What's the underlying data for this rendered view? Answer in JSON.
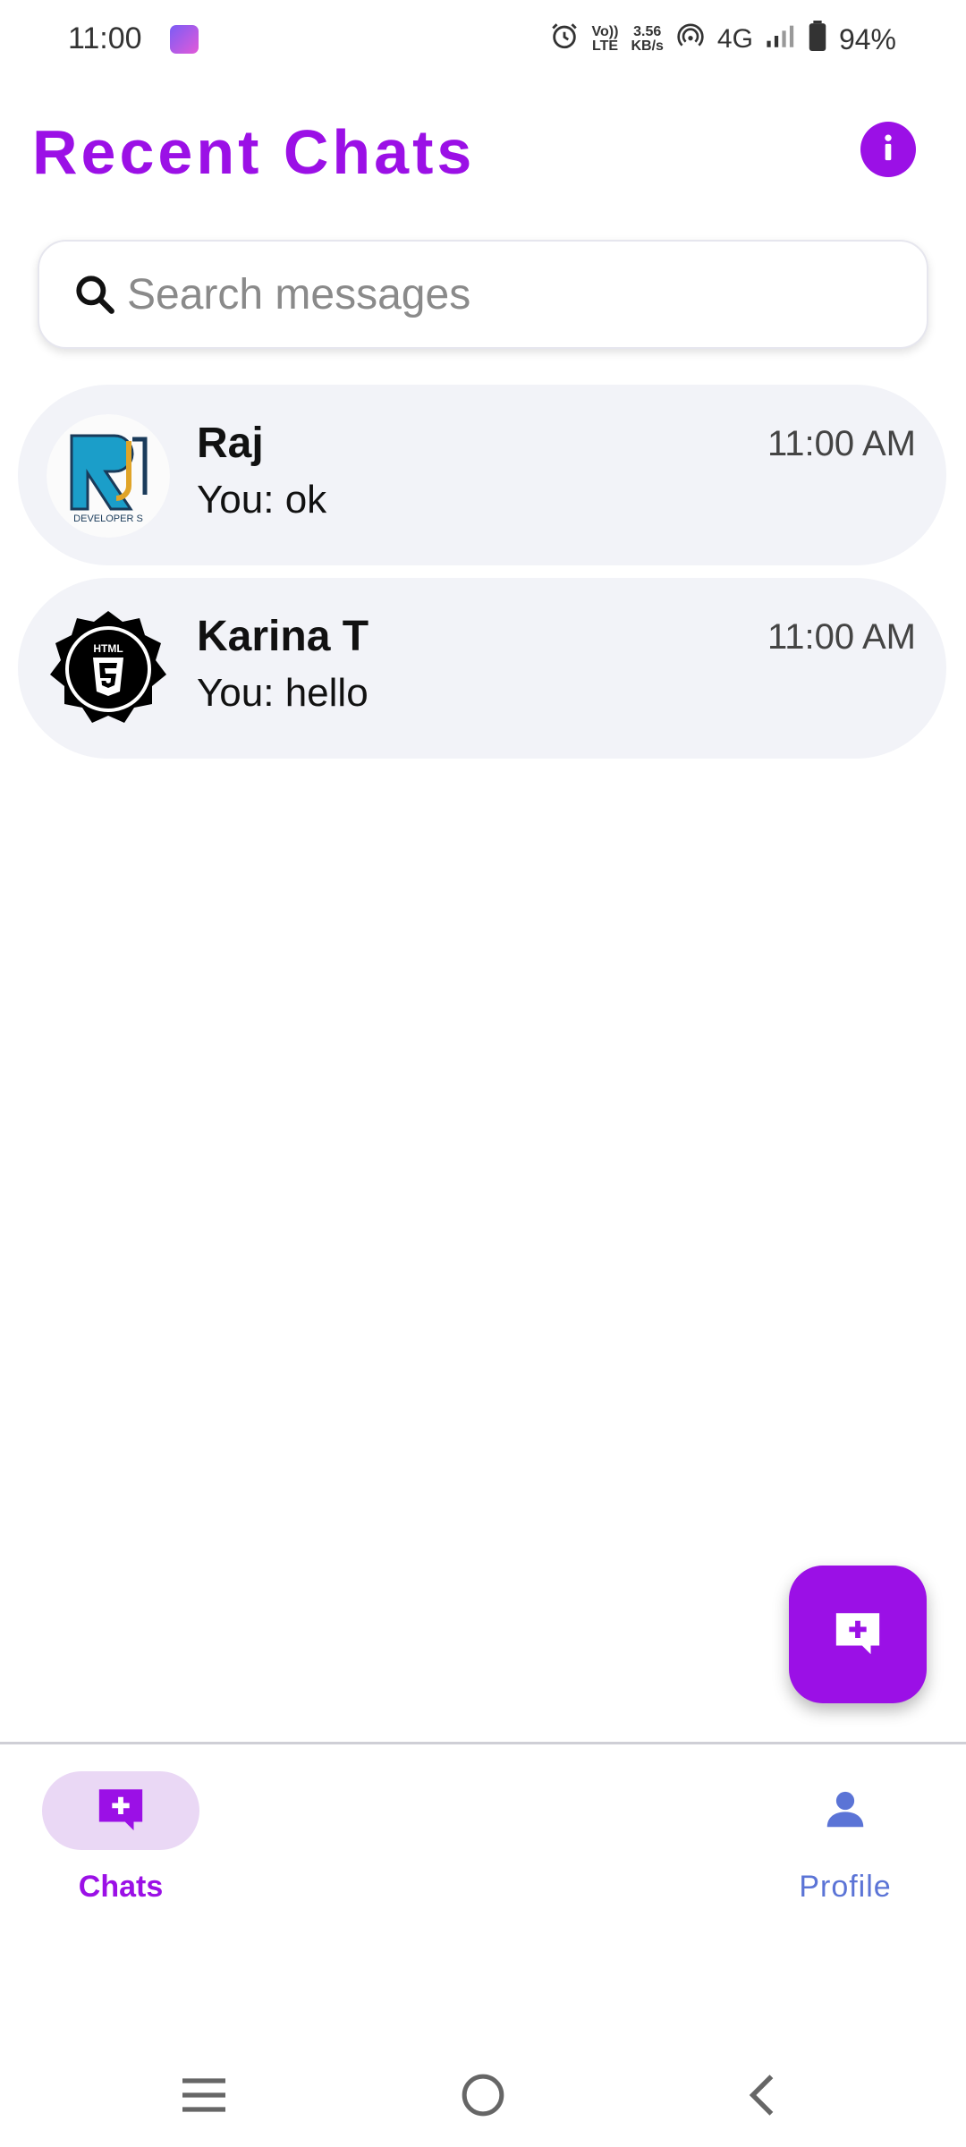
{
  "status_bar": {
    "time": "11:00",
    "volte_top": "Vo))",
    "volte_bottom": "LTE",
    "speed_top": "3.56",
    "speed_bottom": "KB/s",
    "network": "4G",
    "battery": "94%"
  },
  "header": {
    "title": "Recent Chats",
    "info_icon": "info-icon"
  },
  "search": {
    "placeholder": "Search messages",
    "value": ""
  },
  "chats": [
    {
      "name": "Raj",
      "last_message": "You: ok",
      "time": "11:00 AM",
      "avatar_icon": "rj-developers-logo",
      "avatar_caption": "DEVELOPER S"
    },
    {
      "name": "Karina T",
      "last_message": "You: hello",
      "time": "11:00 AM",
      "avatar_icon": "html5-badge-logo",
      "avatar_caption": "HTML"
    }
  ],
  "fab": {
    "icon": "add-chat-icon"
  },
  "bottom_nav": {
    "chats_label": "Chats",
    "profile_label": "Profile"
  },
  "colors": {
    "accent": "#9b10e6",
    "profile_nav": "#5b74d6",
    "chat_item_bg": "#f2f3f8"
  }
}
